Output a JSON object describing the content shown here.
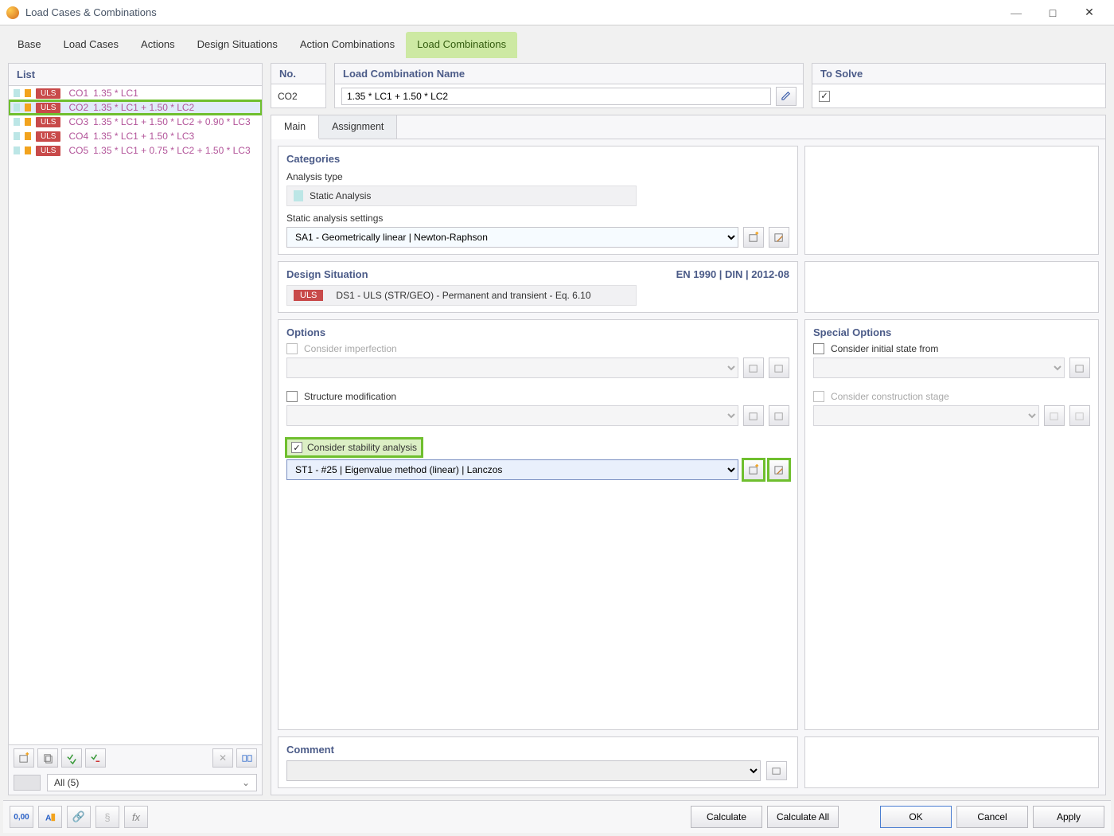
{
  "window": {
    "title": "Load Cases & Combinations"
  },
  "tabs": [
    "Base",
    "Load Cases",
    "Actions",
    "Design Situations",
    "Action Combinations",
    "Load Combinations"
  ],
  "active_tab": "Load Combinations",
  "list": {
    "header": "List",
    "items": [
      {
        "id": "CO1",
        "desc": "1.35 * LC1"
      },
      {
        "id": "CO2",
        "desc": "1.35 * LC1 + 1.50 * LC2"
      },
      {
        "id": "CO3",
        "desc": "1.35 * LC1 + 1.50 * LC2 + 0.90 * LC3"
      },
      {
        "id": "CO4",
        "desc": "1.35 * LC1 + 1.50 * LC3"
      },
      {
        "id": "CO5",
        "desc": "1.35 * LC1 + 0.75 * LC2 + 1.50 * LC3"
      }
    ],
    "uls_badge": "ULS",
    "selected_index": 1,
    "filter_label": "All (5)"
  },
  "header_row": {
    "no_label": "No.",
    "no_value": "CO2",
    "name_label": "Load Combination Name",
    "name_value": "1.35 * LC1 + 1.50 * LC2",
    "solve_label": "To Solve",
    "solve_checked": true
  },
  "subtabs": {
    "main": "Main",
    "assignment": "Assignment"
  },
  "categories": {
    "header": "Categories",
    "analysis_type_label": "Analysis type",
    "analysis_type_value": "Static Analysis",
    "settings_label": "Static analysis settings",
    "settings_value": "SA1 - Geometrically linear | Newton-Raphson"
  },
  "design_situation": {
    "header": "Design Situation",
    "standard": "EN 1990 | DIN | 2012-08",
    "badge": "ULS",
    "value": "DS1 - ULS (STR/GEO) - Permanent and transient - Eq. 6.10"
  },
  "options": {
    "header": "Options",
    "imperfection": "Consider imperfection",
    "structure_mod": "Structure modification",
    "stability": "Consider stability analysis",
    "stability_value": "ST1 - #25 | Eigenvalue method (linear) | Lanczos"
  },
  "special_options": {
    "header": "Special Options",
    "initial_state": "Consider initial state from",
    "construction_stage": "Consider construction stage"
  },
  "comment": {
    "header": "Comment"
  },
  "footer": {
    "calculate": "Calculate",
    "calculate_all": "Calculate All",
    "ok": "OK",
    "cancel": "Cancel",
    "apply": "Apply"
  }
}
